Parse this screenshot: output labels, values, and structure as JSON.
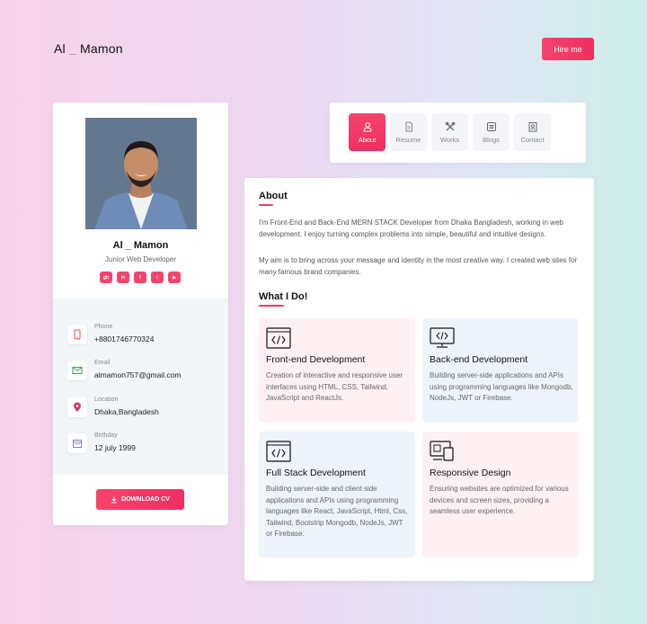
{
  "header": {
    "brand_first": "Al",
    "brand_dash": "_",
    "brand_last": "Mamon",
    "hire_label": "Hire me"
  },
  "profile": {
    "name": "Al _ Mamon",
    "title": "Junior Web Developer",
    "socials": [
      {
        "icon": "github-icon",
        "glyph": "gh"
      },
      {
        "icon": "linkedin-icon",
        "glyph": "in"
      },
      {
        "icon": "facebook-icon",
        "glyph": "f"
      },
      {
        "icon": "twitter-icon",
        "glyph": "t"
      },
      {
        "icon": "youtube-icon",
        "glyph": "▶"
      }
    ],
    "info": [
      {
        "icon": "phone-icon",
        "label": "Phone",
        "value": "+8801746770324"
      },
      {
        "icon": "email-icon",
        "label": "Email",
        "value": "almamon757@gmail.com"
      },
      {
        "icon": "location-icon",
        "label": "Location",
        "value": "Dhaka,Bangladesh"
      },
      {
        "icon": "calendar-icon",
        "label": "Birthday",
        "value": "12 july 1999"
      }
    ],
    "download_label": "DOWNLOAD CV"
  },
  "nav": {
    "tabs": [
      {
        "label": "About",
        "icon": "user-icon",
        "active": true
      },
      {
        "label": "Resume",
        "icon": "document-icon",
        "active": false
      },
      {
        "label": "Works",
        "icon": "tools-icon",
        "active": false
      },
      {
        "label": "Blogs",
        "icon": "blog-icon",
        "active": false
      },
      {
        "label": "Contact",
        "icon": "contact-icon",
        "active": false
      }
    ]
  },
  "about": {
    "heading": "About",
    "para1": "I'm Front-End and Back-End MERN STACK Developer from Dhaka Bangladesh, working in web development. I enjoy turning complex problems into simple, beautiful and intuitive designs.",
    "para2": "My aim is to bring across your message and identity in the most creative way. I created web sites for many famous brand companies.",
    "what_heading": "What I Do!",
    "services": [
      {
        "title": "Front-end Development",
        "icon": "code-icon",
        "bg": "#fff0f3",
        "desc": "Creation of interactive and responsive user interfaces using HTML, CSS, Tailwind, JavaScript and ReactJs."
      },
      {
        "title": "Back-end Development",
        "icon": "monitor-code-icon",
        "bg": "#eef4fc",
        "desc": "Building server-side applications and APIs using programming languages like Mongodb, NodeJs, JWT or Firebase."
      },
      {
        "title": "Full Stack Development",
        "icon": "code-icon",
        "bg": "#eef4fc",
        "desc": "Building server-side and client side applications and APIs using programming languages like React, JavaScript, Html, Css, Tailwind, Bootstrip Mongodb, NodeJs, JWT or Firebase."
      },
      {
        "title": "Responsive Design",
        "icon": "devices-icon",
        "bg": "#fff0f3",
        "desc": "Ensuring websites are optimized for various devices and screen sizes, providing a seamless user experience."
      }
    ]
  },
  "colors": {
    "accent": "#ef3c63",
    "accent_light": "#fff0f3",
    "blue_light": "#eef4fc"
  }
}
